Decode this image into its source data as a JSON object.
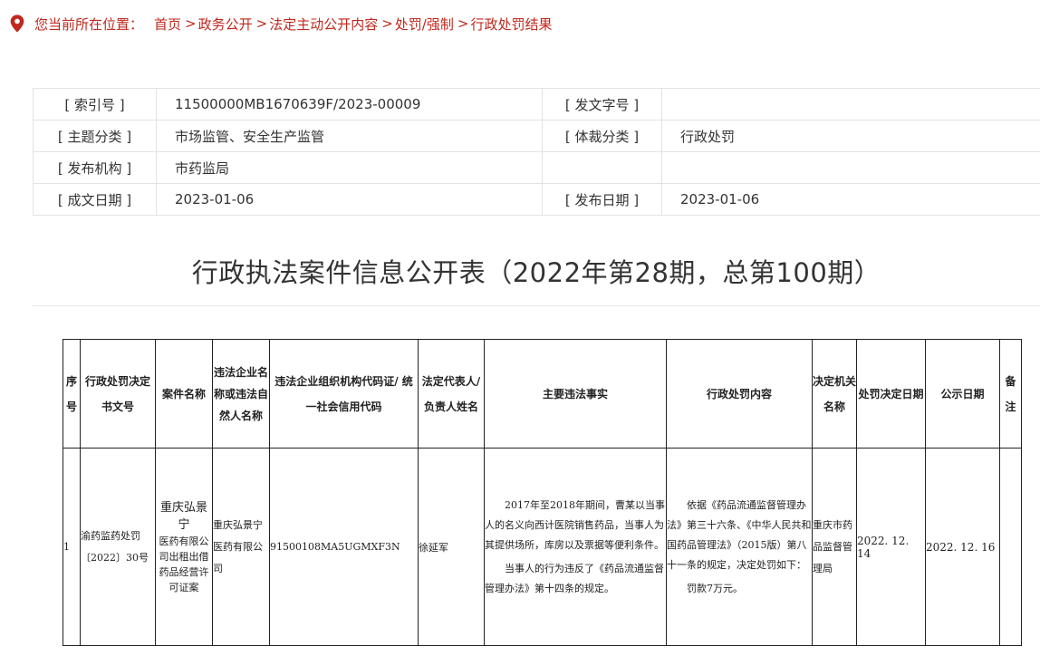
{
  "breadcrumb": {
    "lead": "您当前所在位置：",
    "items": [
      "首页",
      "政务公开",
      "法定主动公开内容",
      "处罚/强制",
      "行政处罚结果"
    ],
    "separator": ">"
  },
  "meta": {
    "index_no_label": "[ 索引号 ]",
    "index_no": "11500000MB1670639F/2023-00009",
    "doc_no_label": "[ 发文字号 ]",
    "doc_no": "",
    "topic_label": "[ 主题分类 ]",
    "topic": "市场监管、安全生产监管",
    "genre_label": "[ 体裁分类 ]",
    "genre": "行政处罚",
    "publisher_label": "[ 发布机构 ]",
    "publisher": "市药监局",
    "created_label": "[ 成文日期 ]",
    "created": "2023-01-06",
    "published_label": "[ 发布日期 ]",
    "published": "2023-01-06"
  },
  "page_title": "行政执法案件信息公开表（2022年第28期，总第100期）",
  "case_table": {
    "headers": {
      "seq": "序号",
      "decision_no": "行政处罚决定书文号",
      "case_name": "案件名称",
      "violator": "违法企业名称或违法自然人名称",
      "credit_code": "违法企业组织机构代码证/ 统一社会信用代码",
      "legal_rep": "法定代表人/负责人姓名",
      "facts": "主要违法事实",
      "penalty": "行政处罚内容",
      "authority": "决定机关名称",
      "decision_date": "处罚决定日期",
      "publish_date": "公示日期",
      "remark": "备注"
    },
    "rows": [
      {
        "seq": "1",
        "decision_no": "渝药监药处罚〔2022〕30号",
        "case_name_1": "重庆弘景宁",
        "case_name_2": "医药有限公司出租出借药品经营许可证案",
        "violator": "重庆弘景宁医药有限公司",
        "credit_code": "91500108MA5UGMXF3N",
        "legal_rep": "徐延军",
        "facts_1": "2017年至2018年期间，曹某以当事人的名义向西计医院销售药品，当事人为其提供场所，库房以及票据等便利条件。",
        "facts_2": "当事人的行为违反了《药品流通监督管理办法》第十四条的规定。",
        "penalty_1": "依据《药品流通监督管理办法》第三十六条、《中华人民共和国药品管理法》（2015版）第八十一条的规定，决定处罚如下：",
        "penalty_2": "罚款7万元。",
        "authority": "重庆市药品监督管理局",
        "decision_date": "2022. 12. 14",
        "publish_date": "2022. 12. 16",
        "remark": ""
      }
    ]
  },
  "colors": {
    "accent": "#c0271d",
    "border_light": "#e3e3e3",
    "table_border": "#222222"
  },
  "icons": {
    "location": "location-pin-icon"
  }
}
